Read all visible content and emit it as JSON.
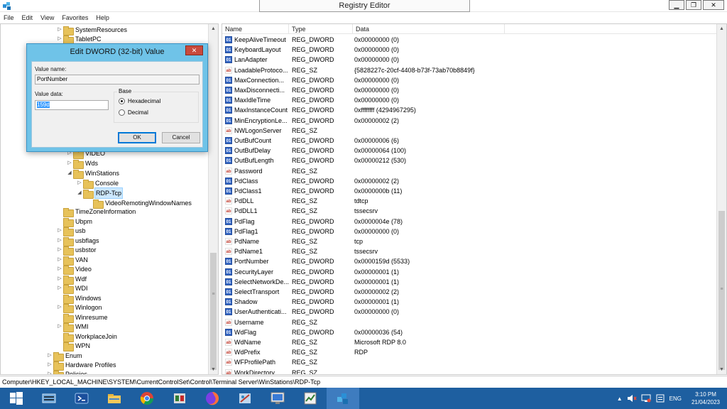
{
  "window": {
    "title": "Registry Editor",
    "minimize": "▁",
    "maximize": "❐",
    "close": "✕"
  },
  "menu": [
    "File",
    "Edit",
    "View",
    "Favorites",
    "Help"
  ],
  "tree": [
    {
      "label": "SystemResources",
      "arrow": "▷"
    },
    {
      "label": "TabletPC",
      "arrow": "▷"
    },
    {
      "label": "VIDEO",
      "arrow": "▷"
    },
    {
      "label": "Wds",
      "arrow": "▷"
    },
    {
      "label": "WinStations",
      "arrow": "◢"
    },
    {
      "label": "Console",
      "arrow": "▷"
    },
    {
      "label": "RDP-Tcp",
      "arrow": "◢"
    },
    {
      "label": "VideoRemotingWindowNames",
      "arrow": ""
    },
    {
      "label": "TimeZoneInformation",
      "arrow": ""
    },
    {
      "label": "Ubpm",
      "arrow": ""
    },
    {
      "label": "usb",
      "arrow": "▷"
    },
    {
      "label": "usbflags",
      "arrow": "▷"
    },
    {
      "label": "usbstor",
      "arrow": "▷"
    },
    {
      "label": "VAN",
      "arrow": "▷"
    },
    {
      "label": "Video",
      "arrow": "▷"
    },
    {
      "label": "Wdf",
      "arrow": "▷"
    },
    {
      "label": "WDI",
      "arrow": "▷"
    },
    {
      "label": "Windows",
      "arrow": ""
    },
    {
      "label": "Winlogon",
      "arrow": "▷"
    },
    {
      "label": "Winresume",
      "arrow": ""
    },
    {
      "label": "WMI",
      "arrow": "▷"
    },
    {
      "label": "WorkplaceJoin",
      "arrow": ""
    },
    {
      "label": "WPN",
      "arrow": ""
    },
    {
      "label": "Enum",
      "arrow": "▷"
    },
    {
      "label": "Hardware Profiles",
      "arrow": "▷"
    },
    {
      "label": "Policies",
      "arrow": "▷"
    }
  ],
  "columns": {
    "name": "Name",
    "type": "Type",
    "data": "Data"
  },
  "values": [
    {
      "name": "KeepAliveTimeout",
      "type": "REG_DWORD",
      "data": "0x00000000 (0)"
    },
    {
      "name": "KeyboardLayout",
      "type": "REG_DWORD",
      "data": "0x00000000 (0)"
    },
    {
      "name": "LanAdapter",
      "type": "REG_DWORD",
      "data": "0x00000000 (0)"
    },
    {
      "name": "LoadableProtoco...",
      "type": "REG_SZ",
      "data": "{5828227c-20cf-4408-b73f-73ab70b8849f}"
    },
    {
      "name": "MaxConnection...",
      "type": "REG_DWORD",
      "data": "0x00000000 (0)"
    },
    {
      "name": "MaxDisconnecti...",
      "type": "REG_DWORD",
      "data": "0x00000000 (0)"
    },
    {
      "name": "MaxIdleTime",
      "type": "REG_DWORD",
      "data": "0x00000000 (0)"
    },
    {
      "name": "MaxInstanceCount",
      "type": "REG_DWORD",
      "data": "0xffffffff (4294967295)"
    },
    {
      "name": "MinEncryptionLe...",
      "type": "REG_DWORD",
      "data": "0x00000002 (2)"
    },
    {
      "name": "NWLogonServer",
      "type": "REG_SZ",
      "data": ""
    },
    {
      "name": "OutBufCount",
      "type": "REG_DWORD",
      "data": "0x00000006 (6)"
    },
    {
      "name": "OutBufDelay",
      "type": "REG_DWORD",
      "data": "0x00000064 (100)"
    },
    {
      "name": "OutBufLength",
      "type": "REG_DWORD",
      "data": "0x00000212 (530)"
    },
    {
      "name": "Password",
      "type": "REG_SZ",
      "data": ""
    },
    {
      "name": "PdClass",
      "type": "REG_DWORD",
      "data": "0x00000002 (2)"
    },
    {
      "name": "PdClass1",
      "type": "REG_DWORD",
      "data": "0x0000000b (11)"
    },
    {
      "name": "PdDLL",
      "type": "REG_SZ",
      "data": "tdtcp"
    },
    {
      "name": "PdDLL1",
      "type": "REG_SZ",
      "data": "tssecsrv"
    },
    {
      "name": "PdFlag",
      "type": "REG_DWORD",
      "data": "0x0000004e (78)"
    },
    {
      "name": "PdFlag1",
      "type": "REG_DWORD",
      "data": "0x00000000 (0)"
    },
    {
      "name": "PdName",
      "type": "REG_SZ",
      "data": "tcp"
    },
    {
      "name": "PdName1",
      "type": "REG_SZ",
      "data": "tssecsrv"
    },
    {
      "name": "PortNumber",
      "type": "REG_DWORD",
      "data": "0x0000159d (5533)"
    },
    {
      "name": "SecurityLayer",
      "type": "REG_DWORD",
      "data": "0x00000001 (1)"
    },
    {
      "name": "SelectNetworkDe...",
      "type": "REG_DWORD",
      "data": "0x00000001 (1)"
    },
    {
      "name": "SelectTransport",
      "type": "REG_DWORD",
      "data": "0x00000002 (2)"
    },
    {
      "name": "Shadow",
      "type": "REG_DWORD",
      "data": "0x00000001 (1)"
    },
    {
      "name": "UserAuthenticati...",
      "type": "REG_DWORD",
      "data": "0x00000000 (0)"
    },
    {
      "name": "Username",
      "type": "REG_SZ",
      "data": ""
    },
    {
      "name": "WdFlag",
      "type": "REG_DWORD",
      "data": "0x00000036 (54)"
    },
    {
      "name": "WdName",
      "type": "REG_SZ",
      "data": "Microsoft RDP 8.0"
    },
    {
      "name": "WdPrefix",
      "type": "REG_SZ",
      "data": "RDP"
    },
    {
      "name": "WFProfilePath",
      "type": "REG_SZ",
      "data": ""
    },
    {
      "name": "WorkDirectory",
      "type": "REG_SZ",
      "data": ""
    }
  ],
  "statusbar": "Computer\\HKEY_LOCAL_MACHINE\\SYSTEM\\CurrentControlSet\\Control\\Terminal Server\\WinStations\\RDP-Tcp",
  "dialog": {
    "title": "Edit DWORD (32-bit) Value",
    "close": "✕",
    "value_name_label": "Value name:",
    "value_name": "PortNumber",
    "value_data_label": "Value data:",
    "value_data": "159d",
    "base_label": "Base",
    "hex_label": "Hexadecimal",
    "dec_label": "Decimal",
    "ok": "OK",
    "cancel": "Cancel"
  },
  "taskbar": {
    "tray_lang": "ENG",
    "time": "3:10 PM",
    "date": "21/04/2023",
    "tray_arrow": "▲"
  },
  "colors": {
    "taskbar": "#1e5fa0",
    "dialog_frame": "#6fc3e8",
    "selection": "#cce8ff"
  }
}
